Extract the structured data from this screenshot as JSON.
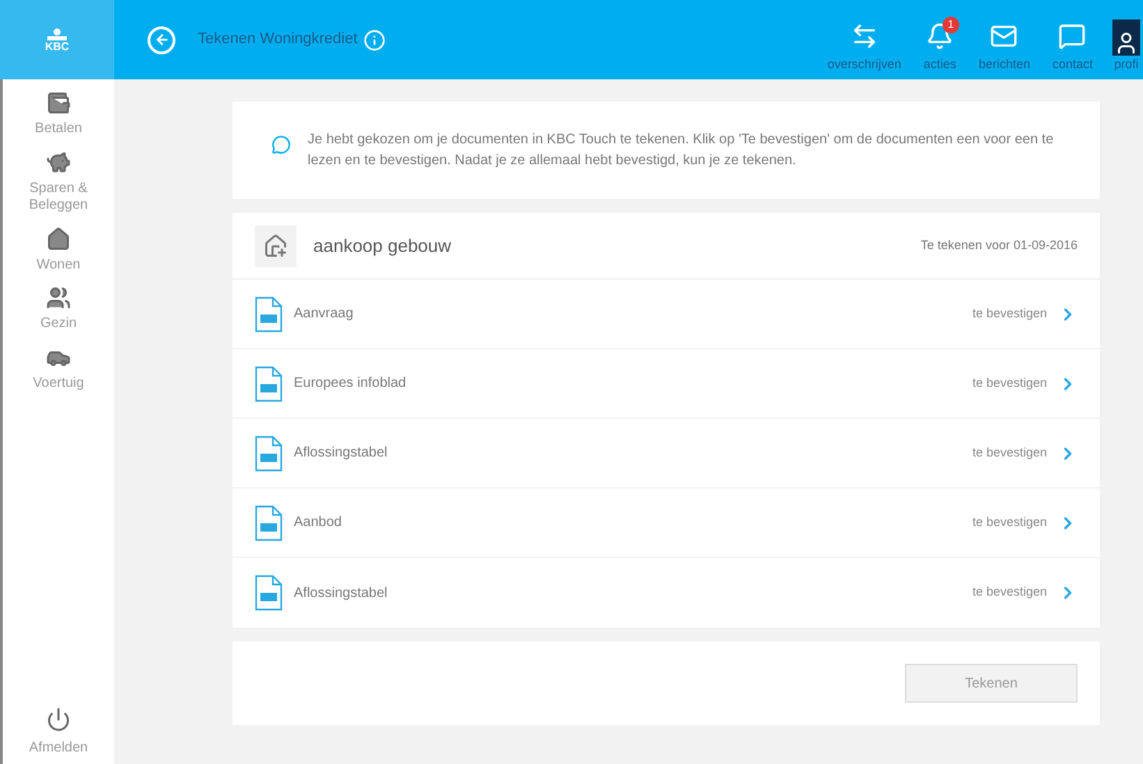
{
  "header": {
    "logo": "KBC",
    "title": "Tekenen Woningkrediet",
    "nav": [
      {
        "kind": "transfer",
        "label": "overschrijven"
      },
      {
        "kind": "bell",
        "label": "acties",
        "badge": "1"
      },
      {
        "kind": "mail",
        "label": "berichten"
      },
      {
        "kind": "chat",
        "label": "contact"
      },
      {
        "kind": "profile",
        "label": "profi"
      }
    ]
  },
  "sidebar": {
    "items": [
      {
        "kind": "wallet",
        "label": "Betalen"
      },
      {
        "kind": "piggy",
        "label": "Sparen & Beleggen"
      },
      {
        "kind": "house",
        "label": "Wonen"
      },
      {
        "kind": "family",
        "label": "Gezin"
      },
      {
        "kind": "car",
        "label": "Voertuig"
      }
    ],
    "logout": "Afmelden"
  },
  "info": "Je hebt gekozen om je documenten in KBC Touch te tekenen. Klik op 'Te bevestigen' om de documenten een voor een te lezen en te bevestigen. Nadat je ze allemaal hebt bevestigd, kun je ze tekenen.",
  "group": {
    "title": "aankoop gebouw",
    "deadline": "Te tekenen voor 01-09-2016",
    "documents": [
      {
        "name": "Aanvraag",
        "status": "te bevestigen"
      },
      {
        "name": "Europees infoblad",
        "status": "te bevestigen"
      },
      {
        "name": "Aflossingstabel",
        "status": "te bevestigen"
      },
      {
        "name": "Aanbod",
        "status": "te bevestigen"
      },
      {
        "name": "Aflossingstabel",
        "status": "te bevestigen"
      }
    ]
  },
  "sign_button": {
    "label": "Tekenen",
    "disabled": true
  }
}
